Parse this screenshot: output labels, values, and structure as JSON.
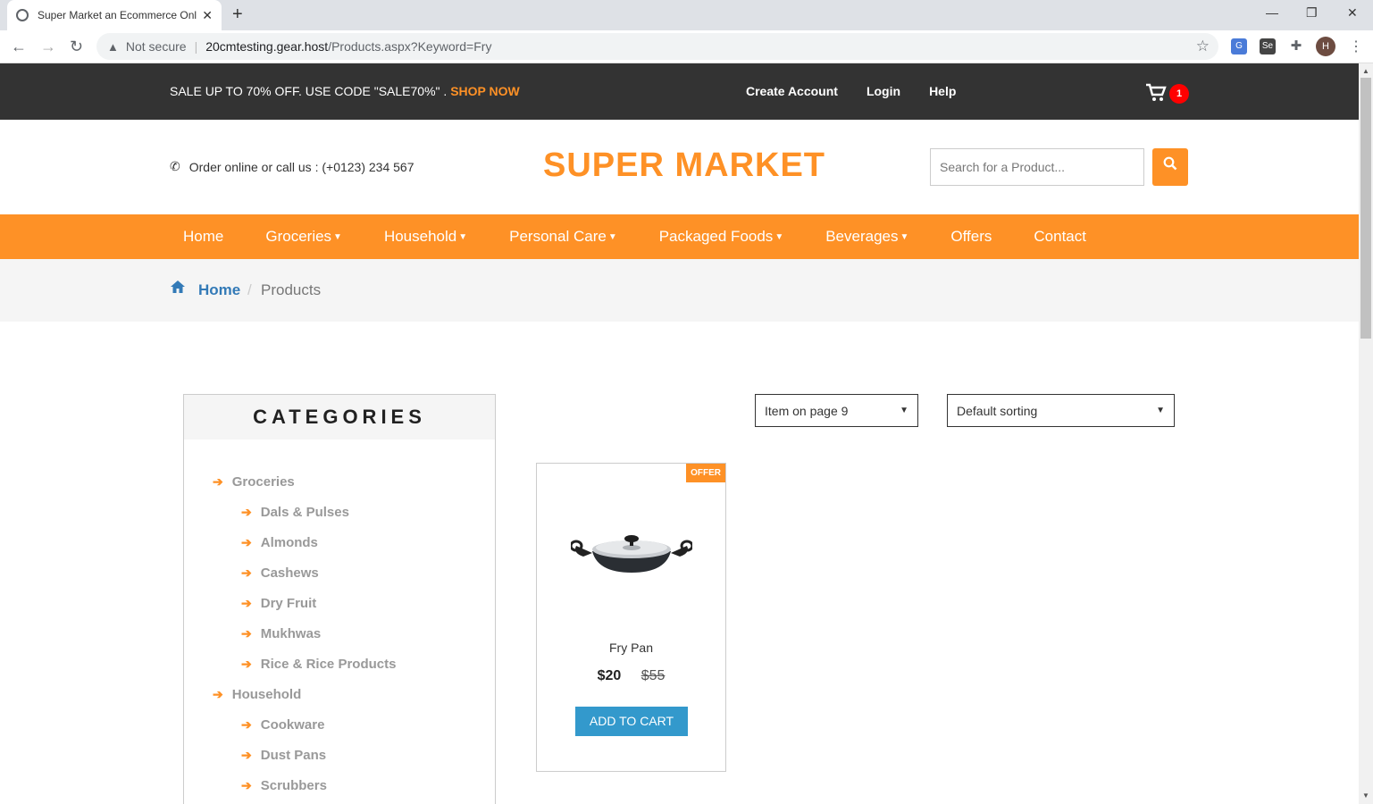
{
  "browser": {
    "tab_title": "Super Market an Ecommerce Onl",
    "not_secure": "Not secure",
    "url_host": "20cmtesting.gear.host",
    "url_path": "/Products.aspx?Keyword=Fry",
    "avatar_letter": "H"
  },
  "topbar": {
    "sale_text": "SALE UP TO 70% OFF. USE CODE \"SALE70%\" . ",
    "shop_now": "SHOP NOW",
    "links": [
      "Create Account",
      "Login",
      "Help"
    ],
    "cart_count": "1"
  },
  "header": {
    "phone_text": "Order online or call us : (+0123) 234 567",
    "logo": "SUPER MARKET",
    "search_placeholder": "Search for a Product..."
  },
  "nav": [
    {
      "label": "Home",
      "dropdown": false
    },
    {
      "label": "Groceries",
      "dropdown": true
    },
    {
      "label": "Household",
      "dropdown": true
    },
    {
      "label": "Personal Care",
      "dropdown": true
    },
    {
      "label": "Packaged Foods",
      "dropdown": true
    },
    {
      "label": "Beverages",
      "dropdown": true
    },
    {
      "label": "Offers",
      "dropdown": false
    },
    {
      "label": "Contact",
      "dropdown": false
    }
  ],
  "breadcrumb": {
    "home": "Home",
    "current": "Products"
  },
  "categories": {
    "title": "CATEGORIES",
    "items": [
      {
        "label": "Groceries",
        "level": 1
      },
      {
        "label": "Dals & Pulses",
        "level": 2
      },
      {
        "label": "Almonds",
        "level": 2
      },
      {
        "label": "Cashews",
        "level": 2
      },
      {
        "label": "Dry Fruit",
        "level": 2
      },
      {
        "label": "Mukhwas",
        "level": 2
      },
      {
        "label": "Rice & Rice Products",
        "level": 2
      },
      {
        "label": "Household",
        "level": 1
      },
      {
        "label": "Cookware",
        "level": 2
      },
      {
        "label": "Dust Pans",
        "level": 2
      },
      {
        "label": "Scrubbers",
        "level": 2
      }
    ]
  },
  "controls": {
    "per_page": "Item on page 9",
    "sorting": "Default sorting"
  },
  "product": {
    "badge": "OFFER",
    "name": "Fry Pan",
    "price": "$20",
    "old_price": "$55",
    "button": "ADD TO CART"
  },
  "colors": {
    "accent": "#fe9126",
    "dark": "#333333",
    "link": "#337ab7",
    "cart_button": "#3399cc",
    "badge_red": "#ff0000"
  }
}
